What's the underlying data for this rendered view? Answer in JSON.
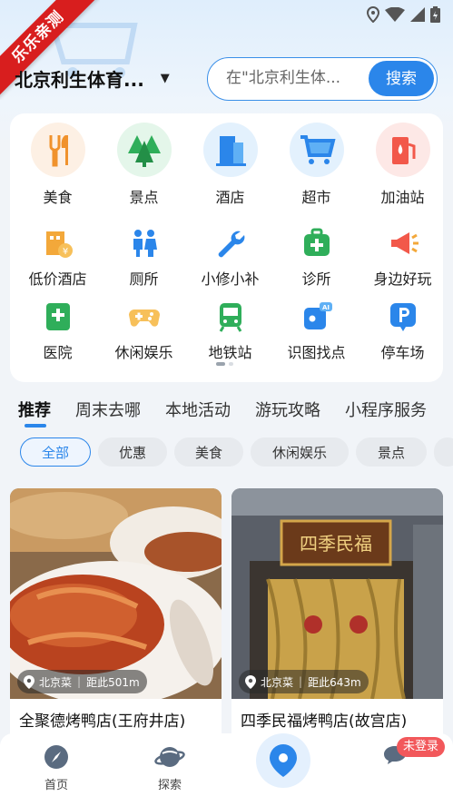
{
  "status_bar": {
    "icons": [
      "location-icon",
      "wifi-icon",
      "signal-icon",
      "battery-icon"
    ]
  },
  "ribbon": {
    "text": "乐乐亲测"
  },
  "header": {
    "city": "北京利生体育...",
    "search_placeholder": "在\"北京利生体...",
    "search_button": "搜索"
  },
  "categories": [
    {
      "label": "美食",
      "icon": "food-icon"
    },
    {
      "label": "景点",
      "icon": "trees-icon"
    },
    {
      "label": "酒店",
      "icon": "building-icon"
    },
    {
      "label": "超市",
      "icon": "shopping-cart-icon"
    },
    {
      "label": "加油站",
      "icon": "gas-station-icon"
    },
    {
      "label": "低价酒店",
      "icon": "budget-hotel-icon"
    },
    {
      "label": "厕所",
      "icon": "restroom-icon"
    },
    {
      "label": "小修小补",
      "icon": "wrench-icon"
    },
    {
      "label": "诊所",
      "icon": "medical-kit-icon"
    },
    {
      "label": "身边好玩",
      "icon": "megaphone-icon"
    },
    {
      "label": "医院",
      "icon": "hospital-icon"
    },
    {
      "label": "休闲娱乐",
      "icon": "gamepad-icon"
    },
    {
      "label": "地铁站",
      "icon": "subway-icon"
    },
    {
      "label": "识图找点",
      "icon": "ai-camera-icon"
    },
    {
      "label": "停车场",
      "icon": "parking-icon"
    }
  ],
  "tabs": [
    "推荐",
    "周末去哪",
    "本地活动",
    "游玩攻略",
    "小程序服务"
  ],
  "chips": [
    "全部",
    "优惠",
    "美食",
    "休闲娱乐",
    "景点",
    ""
  ],
  "feed": [
    {
      "category": "北京菜",
      "distance": "距此501m",
      "title": "全聚德烤鸭店(王府井店)"
    },
    {
      "category": "北京菜",
      "distance": "距此643m",
      "title": "四季民福烤鸭店(故宫店)",
      "sign_text": "四季民福"
    }
  ],
  "bottom_nav": {
    "home": "首页",
    "explore": "探索",
    "login_badge": "未登录"
  },
  "colors": {
    "accent": "#2b86ea",
    "ribbon": "#d81e1e",
    "badge": "#f2585b"
  }
}
